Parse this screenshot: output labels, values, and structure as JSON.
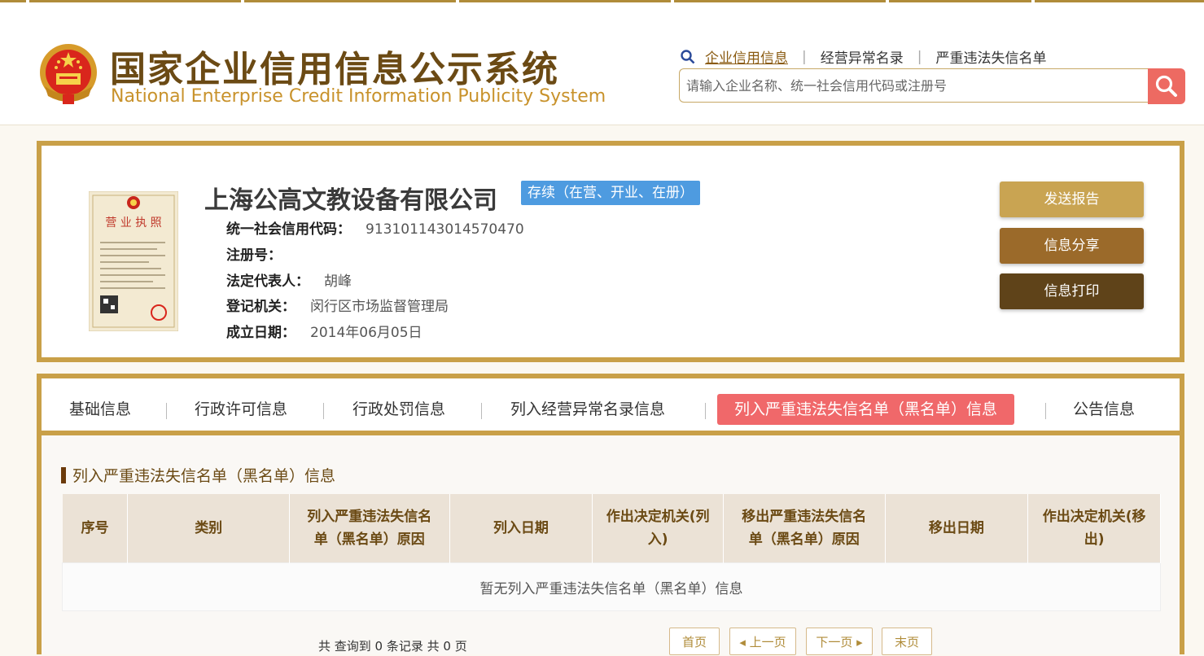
{
  "header": {
    "title_cn": "国家企业信用信息公示系统",
    "title_en": "National Enterprise Credit Information Publicity System",
    "nav": [
      "企业信用信息",
      "经营异常名录",
      "严重违法失信名单"
    ],
    "search_placeholder": "请输入企业名称、统一社会信用代码或注册号"
  },
  "company": {
    "name": "上海公高文教设备有限公司",
    "status": "存续（在营、开业、在册）",
    "license_label": "营 业 执 照",
    "fields": [
      {
        "label": "统一社会信用代码：",
        "value": "913101143014570470"
      },
      {
        "label": "注册号：",
        "value": ""
      },
      {
        "label": "法定代表人：",
        "value": "胡峰"
      },
      {
        "label": "登记机关：",
        "value": "闵行区市场监督管理局"
      },
      {
        "label": "成立日期：",
        "value": "2014年06月05日"
      }
    ]
  },
  "actions": [
    "发送报告",
    "信息分享",
    "信息打印"
  ],
  "action_colors": [
    "#c9a452",
    "#9b6a2a",
    "#5f4319"
  ],
  "tabs": [
    "基础信息",
    "行政许可信息",
    "行政处罚信息",
    "列入经营异常名录信息",
    "列入严重违法失信名单（黑名单）信息",
    "公告信息"
  ],
  "active_tab_index": 4,
  "section": {
    "title": "列入严重违法失信名单（黑名单）信息",
    "columns": [
      "序号",
      "类别",
      "列入严重违法失信名单（黑名单）原因",
      "列入日期",
      "作出决定机关(列入)",
      "移出严重违法失信名单（黑名单）原因",
      "移出日期",
      "作出决定机关(移出)"
    ],
    "empty_message": "暂无列入严重违法失信名单（黑名单）信息"
  },
  "pagination": {
    "summary": "共 查询到 0 条记录 共 0 页",
    "buttons": [
      "首页",
      "上一页",
      "下一页",
      "末页"
    ]
  },
  "colors": {
    "brand_brown": "#6b4a14",
    "gold_border": "#c9a048",
    "active_tab": "#f0686a",
    "status_badge": "#4e9be0",
    "search_button": "#ed6a62"
  }
}
